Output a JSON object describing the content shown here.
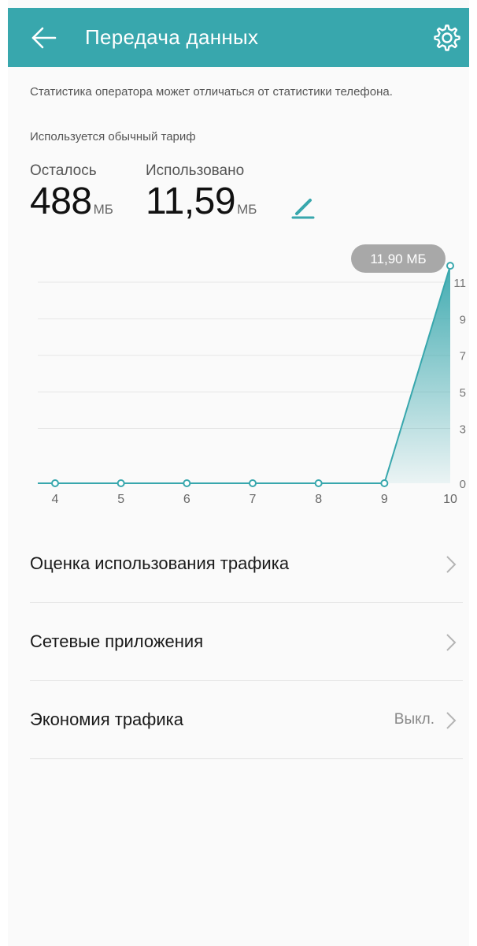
{
  "app_bar": {
    "title": "Передача данных",
    "back_icon": "arrow-left-icon",
    "settings_icon": "gear-icon",
    "background": "#38a7ad"
  },
  "notice": "Статистика оператора может отличаться от статистики телефона.",
  "plan_text": "Используется обычный тариф",
  "stats": {
    "remaining": {
      "label": "Осталось",
      "value": "488",
      "unit": "МБ"
    },
    "used": {
      "label": "Использовано",
      "value": "11,59",
      "unit": "МБ"
    },
    "edit_icon": "pencil-icon"
  },
  "chart_data": {
    "type": "area",
    "x": [
      4,
      5,
      6,
      7,
      8,
      9,
      10
    ],
    "x_tick_labels": [
      "4",
      "5",
      "6",
      "7",
      "8",
      "9",
      "10"
    ],
    "values": [
      0,
      0,
      0,
      0,
      0,
      0,
      11.9
    ],
    "y_ticks": [
      0,
      3,
      5,
      7,
      9,
      11
    ],
    "ylim": [
      0,
      11
    ],
    "grid": true,
    "y_axis_side": "right",
    "callout": "11,90 МБ",
    "color": "#38a7ad"
  },
  "menu": [
    {
      "label": "Оценка использования трафика",
      "value": "",
      "chevron_icon": "chevron-right-icon"
    },
    {
      "label": "Сетевые приложения",
      "value": "",
      "chevron_icon": "chevron-right-icon"
    },
    {
      "label": "Экономия трафика",
      "value": "Выкл.",
      "chevron_icon": "chevron-right-icon"
    }
  ]
}
